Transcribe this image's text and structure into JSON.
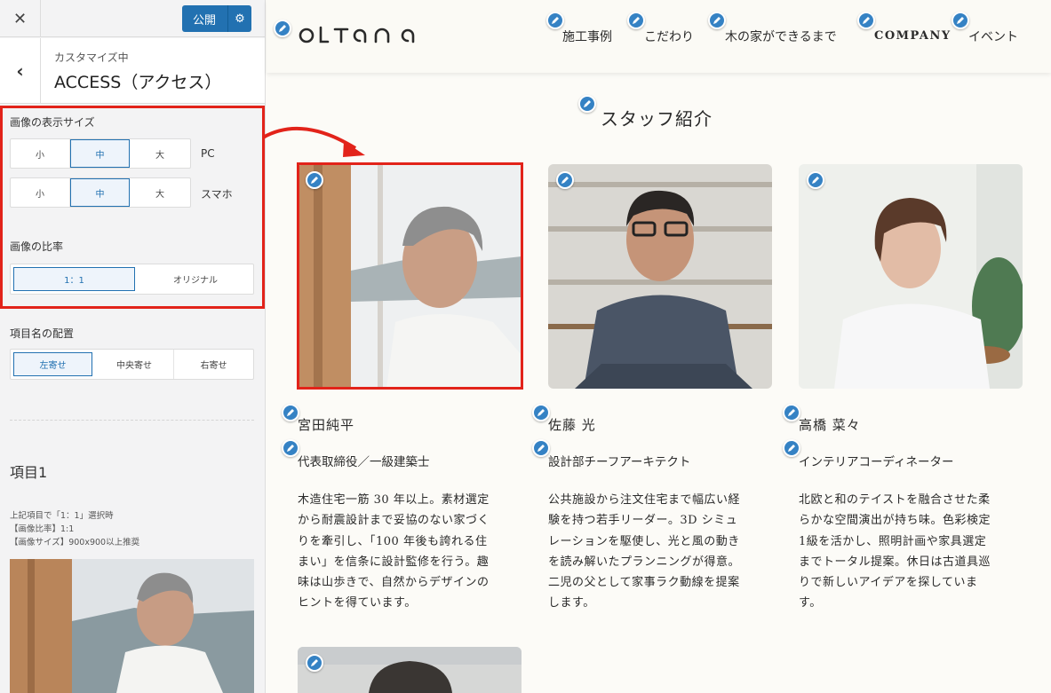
{
  "customizer": {
    "close_glyph": "✕",
    "publish_label": "公開",
    "back_glyph": "‹",
    "breadcrumb": "カスタマイズ中",
    "title": "ACCESS（アクセス）",
    "size_label": "画像の表示サイズ",
    "size_options": [
      "小",
      "中",
      "大"
    ],
    "size_pc_selected": "中",
    "size_sp_selected": "中",
    "device_pc": "PC",
    "device_sp": "スマホ",
    "ratio_label": "画像の比率",
    "ratio_options": [
      "1：1",
      "オリジナル"
    ],
    "ratio_selected": "1：1",
    "align_label": "項目名の配置",
    "align_options": [
      "左寄せ",
      "中央寄せ",
      "右寄せ"
    ],
    "align_selected": "左寄せ",
    "item_title": "項目1",
    "notes": [
      "上記項目で「1：1」選択時",
      "【画像比率】1:1",
      "【画像サイズ】900x900以上推奨"
    ]
  },
  "site": {
    "logo": "OLTANA",
    "nav": [
      "施工事例",
      "こだわり",
      "木の家ができるまで",
      "COMPANY",
      "イベント"
    ],
    "section_title": "スタッフ紹介",
    "staff": [
      {
        "name": "宮田純平",
        "role": "代表取締役／一級建築士",
        "desc_lines": [
          "木造住宅一筋 30 年以上。素材選定",
          "から耐震設計まで妥協のない家づく",
          "りを牽引し、「100 年後も誇れる住",
          "まい」を信条に設計監修を行う。趣",
          "味は山歩きで、自然からデザインの",
          "ヒントを得ています。"
        ]
      },
      {
        "name": "佐藤 光",
        "role": "設計部チーフアーキテクト",
        "desc_lines": [
          "公共施設から注文住宅まで幅広い経",
          "験を持つ若手リーダー。3D シミュ",
          "レーションを駆使し、光と風の動き",
          "を読み解いたプランニングが得意。",
          "二児の父として家事ラク動線を提案",
          "します。"
        ]
      },
      {
        "name": "高橋 菜々",
        "role": "インテリアコーディネーター",
        "desc_lines": [
          "北欧と和のテイストを融合させた柔",
          "らかな空間演出が持ち味。色彩検定",
          "1級を活かし、照明計画や家具選定",
          "までトータル提案。休日は古道具巡",
          "りで新しいアイデアを探していま",
          "す。"
        ]
      }
    ]
  },
  "colors": {
    "accent_blue": "#2271b1",
    "highlight_red": "#e2231a",
    "pencil_blue": "#3582c4"
  }
}
